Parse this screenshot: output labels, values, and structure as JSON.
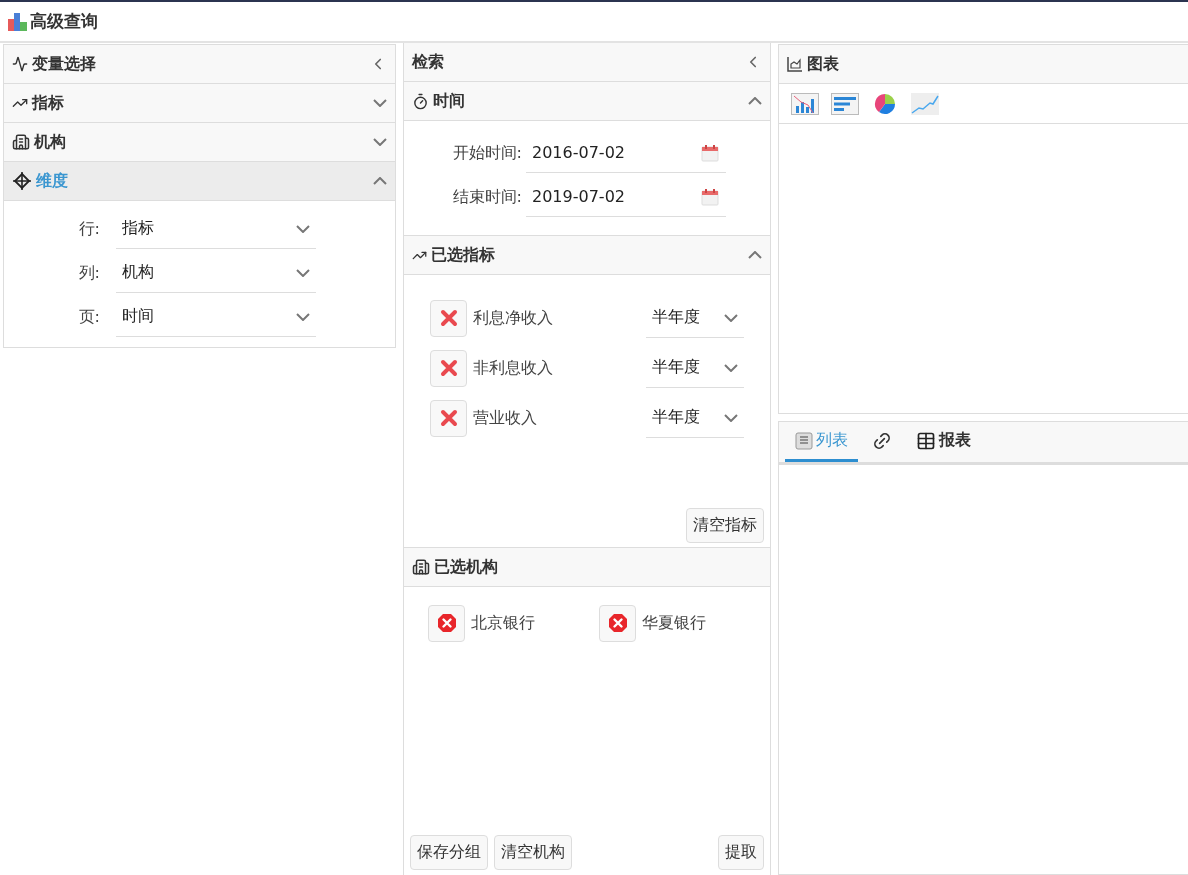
{
  "window": {
    "title": "高级查询"
  },
  "variable_panel": {
    "title": "变量选择",
    "sections": [
      {
        "kind": "indicator",
        "label": "指标",
        "expanded": false
      },
      {
        "kind": "org",
        "label": "机构",
        "expanded": false
      },
      {
        "kind": "dimension",
        "label": "维度",
        "expanded": true,
        "fields": [
          {
            "label": "行:",
            "value": "指标"
          },
          {
            "label": "列:",
            "value": "机构"
          },
          {
            "label": "页:",
            "value": "时间"
          }
        ]
      }
    ]
  },
  "search_panel": {
    "title": "检索",
    "time": {
      "title": "时间",
      "expanded": true,
      "fields": [
        {
          "label": "开始时间:",
          "value": "2016-07-02"
        },
        {
          "label": "结束时间:",
          "value": "2019-07-02"
        }
      ]
    },
    "indicators": {
      "title": "已选指标",
      "expanded": true,
      "items": [
        {
          "name": "利息净收入",
          "period": "半年度"
        },
        {
          "name": "非利息收入",
          "period": "半年度"
        },
        {
          "name": "营业收入",
          "period": "半年度"
        }
      ],
      "clear_button": "清空指标"
    },
    "orgs": {
      "title": "已选机构",
      "items": [
        "北京银行",
        "华夏银行"
      ]
    },
    "buttons": [
      {
        "label": "保存分组",
        "kind": "left"
      },
      {
        "label": "清空机构",
        "kind": "left"
      },
      {
        "label": "提取",
        "kind": "right"
      }
    ]
  },
  "chart_panel": {
    "title": "图表",
    "chart_types": [
      {
        "kind": "bar"
      },
      {
        "kind": "hbar"
      },
      {
        "kind": "pie"
      },
      {
        "kind": "line"
      }
    ]
  },
  "tabs": [
    {
      "kind": "list",
      "label": "列表",
      "selected": true
    },
    {
      "kind": "link",
      "selected": false
    },
    {
      "kind": "report",
      "label": "报表",
      "selected": false
    }
  ]
}
